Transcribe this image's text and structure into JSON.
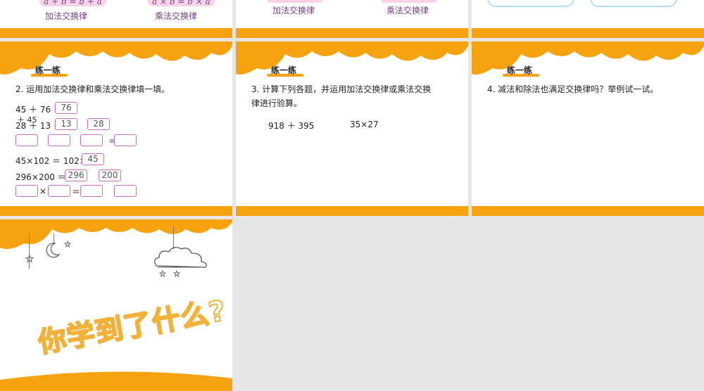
{
  "slide1": {
    "formula_add": "a + b = b + a",
    "formula_mul": "a × b = b × a",
    "law_add": "加法交换律",
    "law_mul": "乘法交换律"
  },
  "slide2": {
    "law_add": "加法交换律",
    "law_mul": "乘法交换律"
  },
  "practice_label": "练一练",
  "q2": {
    "text": "2. 运用加法交换律和乘法交换律填一填。",
    "line1_left": "45 ＋ 76 ＝",
    "line1_box": "76",
    "line1_under": "＋ 45",
    "line2_left": "28 ＋ 13 ＝",
    "line2_box1": "13",
    "line2_box2": "28",
    "row3_eq": "＝",
    "line4_left": "45×102 ＝ 102×",
    "line4_box": "45",
    "line5_left": "296×200 ＝",
    "line5_box1": "296",
    "line5_box2": "200",
    "row6_times": "×",
    "row6_eq": "＝"
  },
  "q3": {
    "text_l1": "3. 计算下列各题，并运用加法交换律或乘法交换",
    "text_l2": "律进行验算。",
    "expr1": "918 ＋ 395",
    "expr2": "35×27"
  },
  "q4": {
    "text": "4. 减法和除法也满足交换律吗？举例试一试。"
  },
  "summary": {
    "title": "你学到了什么?"
  },
  "colors": {
    "accent_orange": "#f7a20f",
    "box_border": "#c86fc4",
    "law_text": "#7a3f8a"
  }
}
